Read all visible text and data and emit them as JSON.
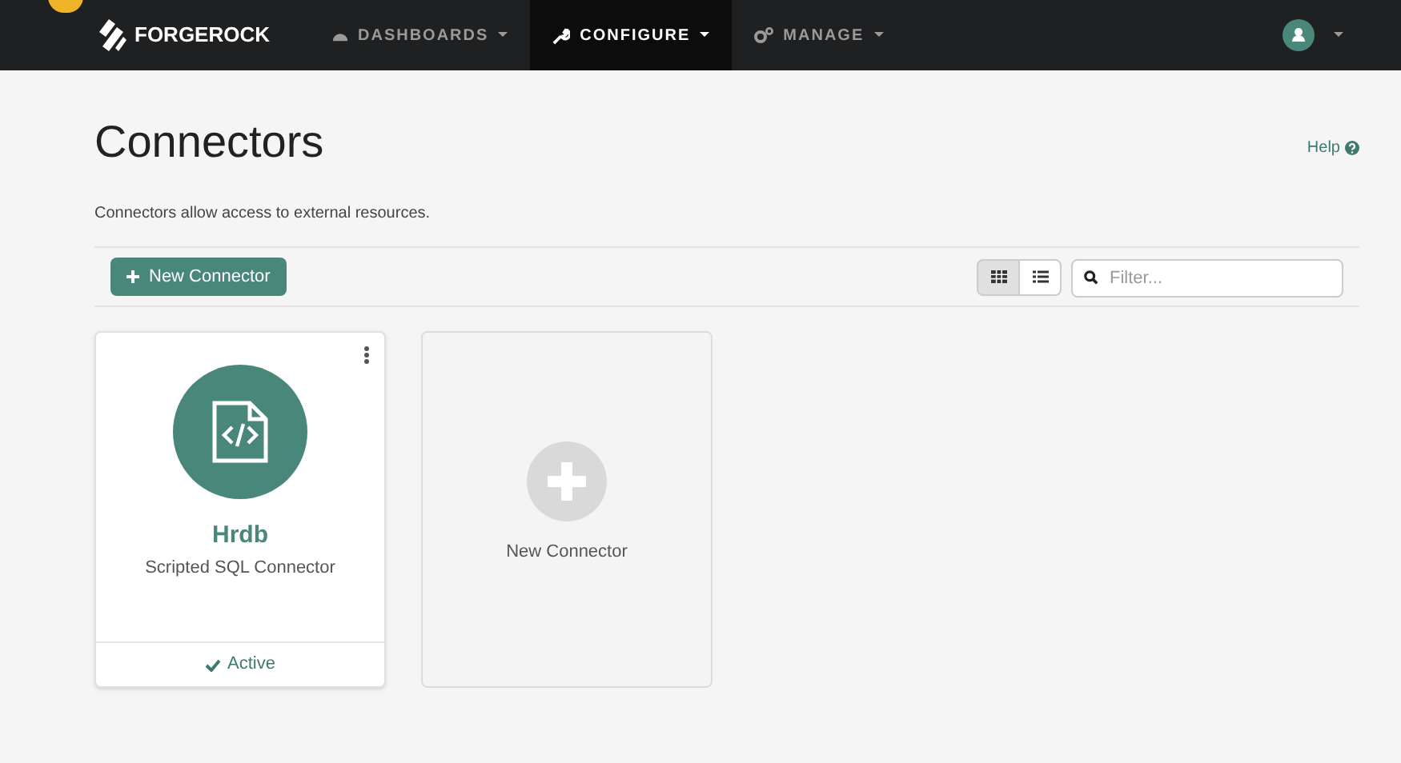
{
  "brand": {
    "name": "FORGEROCK"
  },
  "nav": [
    {
      "label": "DASHBOARDS",
      "kind": "dashboards",
      "selected": false
    },
    {
      "label": "CONFIGURE",
      "kind": "configure",
      "selected": true
    },
    {
      "label": "MANAGE",
      "kind": "manage",
      "selected": false
    }
  ],
  "page": {
    "title": "Connectors",
    "help": "Help",
    "description": "Connectors allow access to external resources."
  },
  "toolbar": {
    "new_button": "New Connector",
    "views": [
      {
        "kind": "grid",
        "selected": true
      },
      {
        "kind": "list",
        "selected": false
      }
    ],
    "filter": {
      "placeholder": "Filter..."
    }
  },
  "cards": [
    {
      "kind": "connector",
      "name": "Hrdb",
      "type": "Scripted SQL Connector",
      "status": "Active",
      "active": true
    },
    {
      "kind": "new",
      "label": "New Connector"
    }
  ]
}
